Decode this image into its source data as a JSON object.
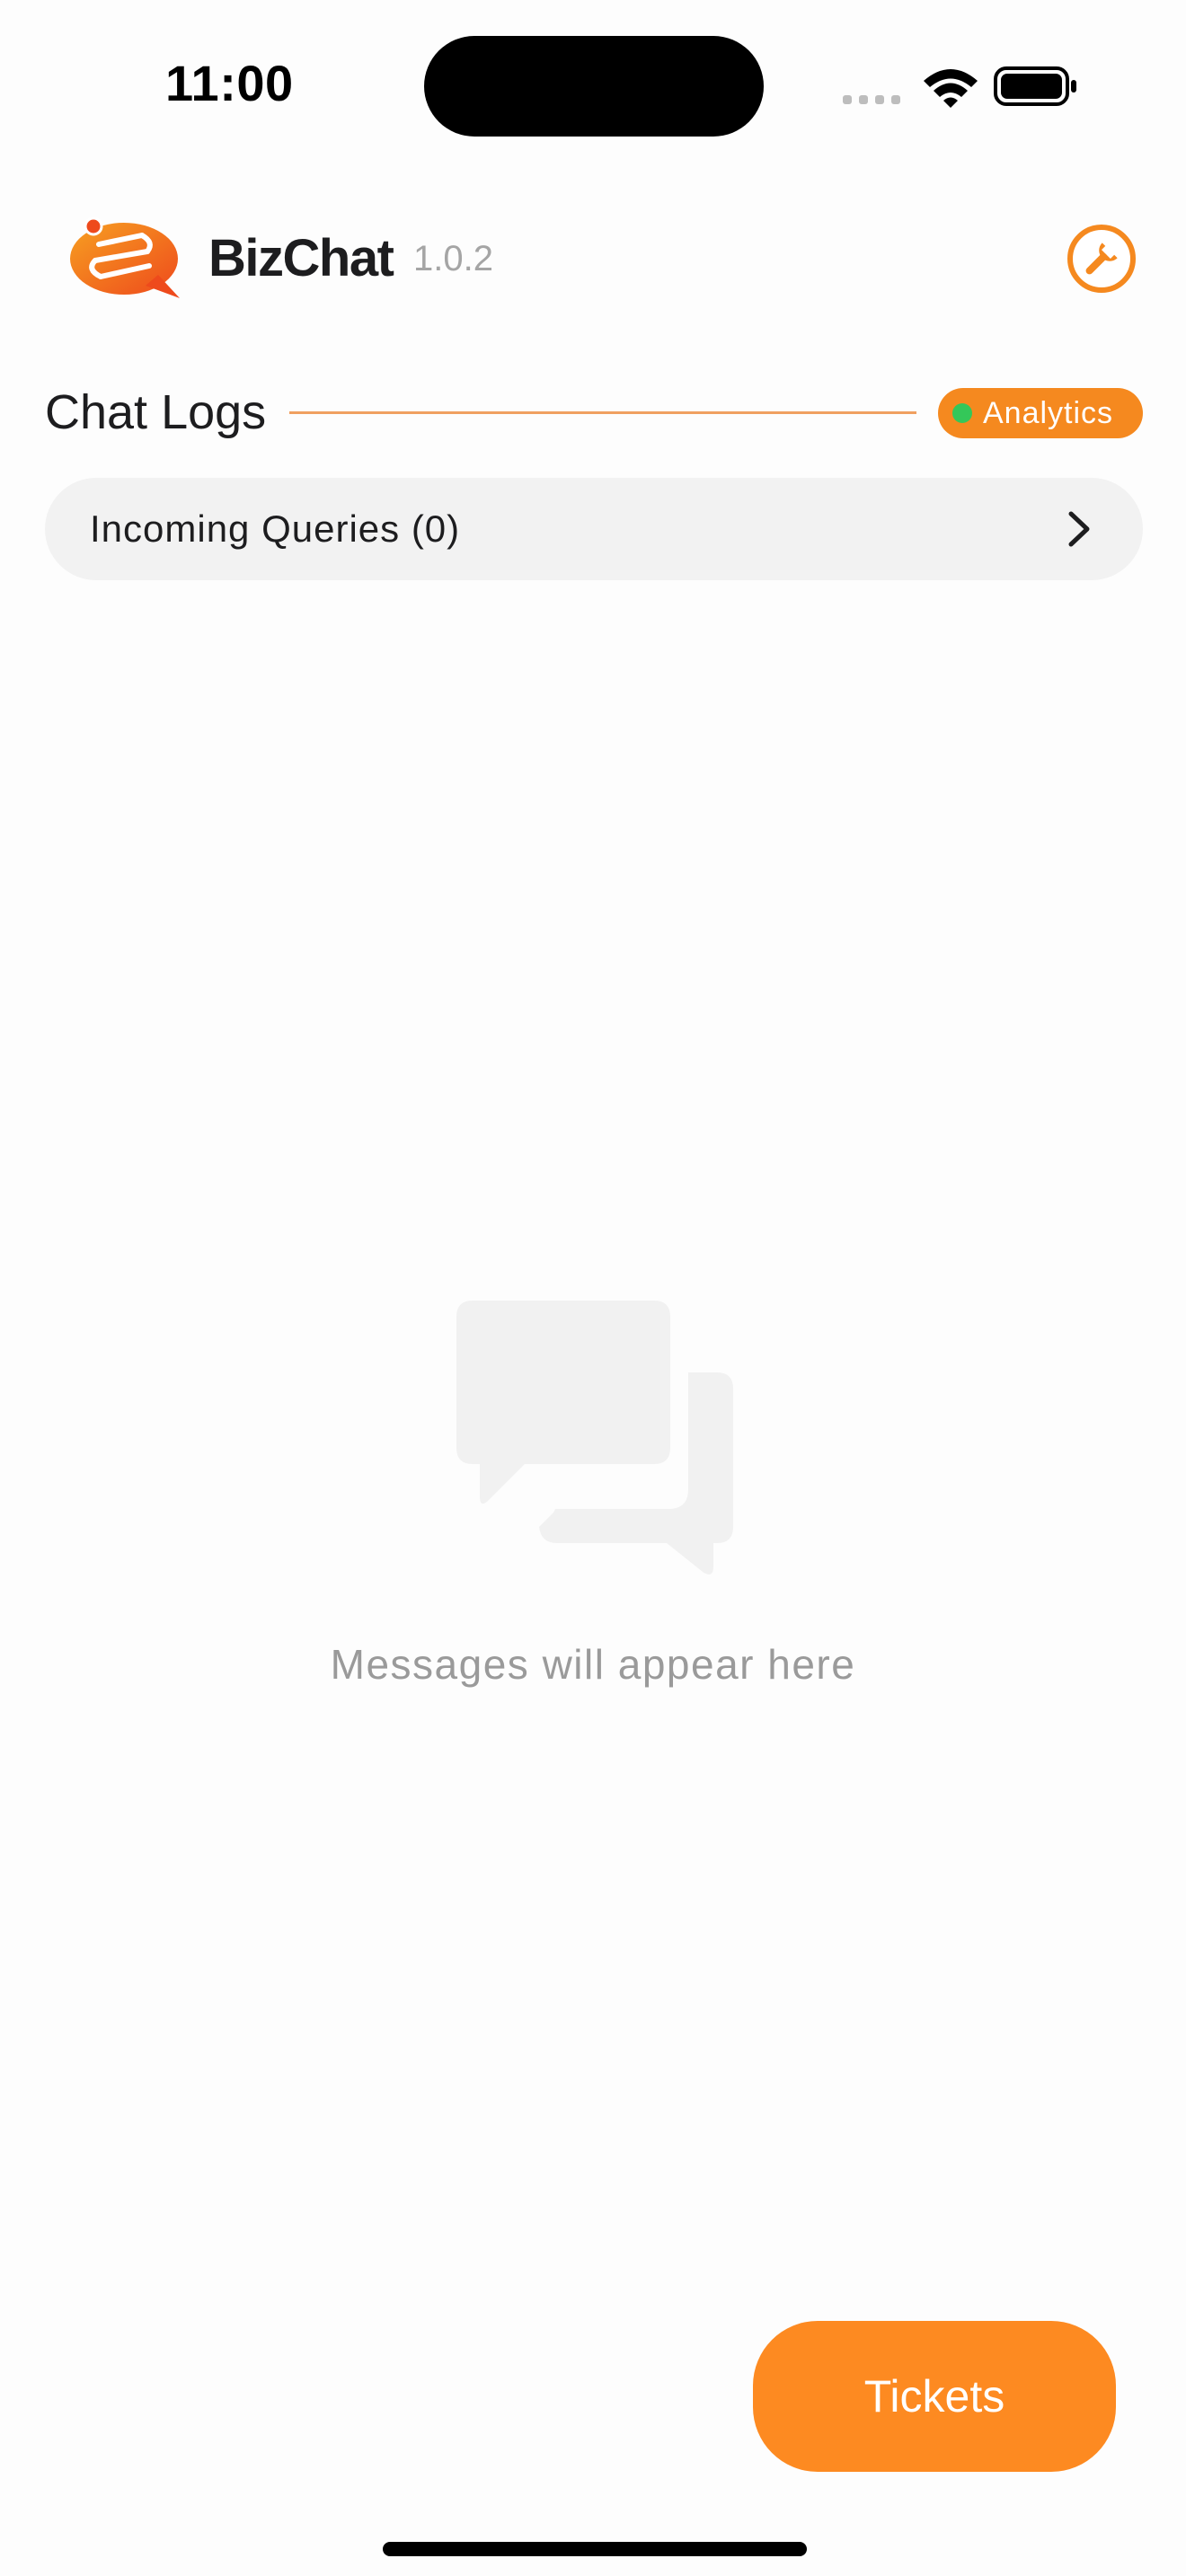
{
  "status_bar": {
    "time": "11:00"
  },
  "header": {
    "app_name": "BizChat",
    "version": "1.0.2",
    "settings_icon": "wrench-icon"
  },
  "section": {
    "title": "Chat Logs",
    "badge_label": "Analytics",
    "badge_dot_color": "#34c759"
  },
  "queries": {
    "label": "Incoming Queries (0)"
  },
  "empty_state": {
    "icon": "chat-bubbles-icon",
    "message": "Messages will appear here"
  },
  "actions": {
    "tickets_label": "Tickets"
  },
  "theme": {
    "accent": "#f5891f",
    "button_accent": "#fd8a21"
  }
}
